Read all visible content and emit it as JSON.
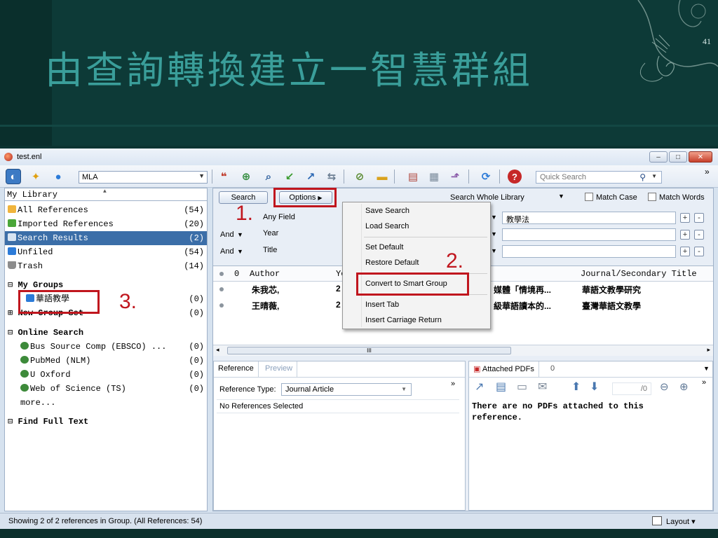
{
  "slide": {
    "title": "由查詢轉換建立一智慧群組",
    "page_number": "41"
  },
  "window": {
    "title": "test.enl",
    "buttons": {
      "minimize": "–",
      "maximize": "□",
      "close": "✕"
    }
  },
  "toolbar": {
    "style_value": "MLA",
    "quick_search_placeholder": "Quick Search",
    "overflow": "»"
  },
  "sidebar": {
    "header": "My Library",
    "items": [
      {
        "label": "All References",
        "count": "(54)"
      },
      {
        "label": "Imported References",
        "count": "(20)"
      },
      {
        "label": "Search Results",
        "count": "(2)"
      },
      {
        "label": "Unfiled",
        "count": "(54)"
      },
      {
        "label": "Trash",
        "count": "(14)"
      }
    ],
    "my_groups": {
      "label": "My Groups",
      "group": {
        "label": "華語教學",
        "count": "(0)"
      }
    },
    "new_group_set": {
      "label": "New Group Set",
      "count": "(0)"
    },
    "online_search": {
      "label": "Online Search",
      "items": [
        {
          "label": "Bus Source Comp (EBSCO) ...",
          "count": "(0)"
        },
        {
          "label": "PubMed (NLM)",
          "count": "(0)"
        },
        {
          "label": "U Oxford",
          "count": "(0)"
        },
        {
          "label": "Web of Science (TS)",
          "count": "(0)"
        }
      ],
      "more": "more..."
    },
    "find_full_text": "Find Full Text"
  },
  "search_panel": {
    "search_button": "Search",
    "options_button": "Options",
    "scope": "Search Whole Library",
    "match_case": "Match Case",
    "match_words": "Match Words",
    "rows": [
      {
        "bool": "",
        "field": "Any Field",
        "value": "教學法"
      },
      {
        "bool": "And",
        "field": "Year",
        "value": ""
      },
      {
        "bool": "And",
        "field": "Title",
        "value": ""
      }
    ]
  },
  "reference_list": {
    "columns": {
      "author": "Author",
      "year": "Ye",
      "journal": "Journal/Secondary Title"
    },
    "rows": [
      {
        "author": "朱我芯,",
        "year": "2",
        "title": "媒體「情境再...",
        "journal": "華語文教學研究"
      },
      {
        "author": "王晴薇,",
        "year": "2",
        "title": "級華語讀本的...",
        "journal": "臺灣華語文教學"
      }
    ],
    "scroll_marker": "III"
  },
  "options_menu": {
    "items": [
      "Save Search",
      "Load Search",
      "Set Default",
      "Restore Default",
      "Convert to Smart Group",
      "Insert Tab",
      "Insert Carriage Return"
    ]
  },
  "reference_panel": {
    "tabs": [
      "Reference",
      "Preview"
    ],
    "type_label": "Reference Type:",
    "type_value": "Journal Article",
    "message": "No References Selected",
    "overflow": "»"
  },
  "pdf_panel": {
    "tab": "Attached PDFs",
    "page_indicator": "/0",
    "message": "There are no PDFs attached to this reference.",
    "overflow": "»"
  },
  "statusbar": {
    "text": "Showing 2 of 2 references in Group. (All References: 54)",
    "layout": "Layout"
  },
  "annotations": {
    "step1": "1.",
    "step2": "2.",
    "step3": "3."
  },
  "colors": {
    "annotation_red": "#c0161e",
    "selection_blue": "#3b6ea8",
    "title_teal": "#3a9e9a"
  }
}
